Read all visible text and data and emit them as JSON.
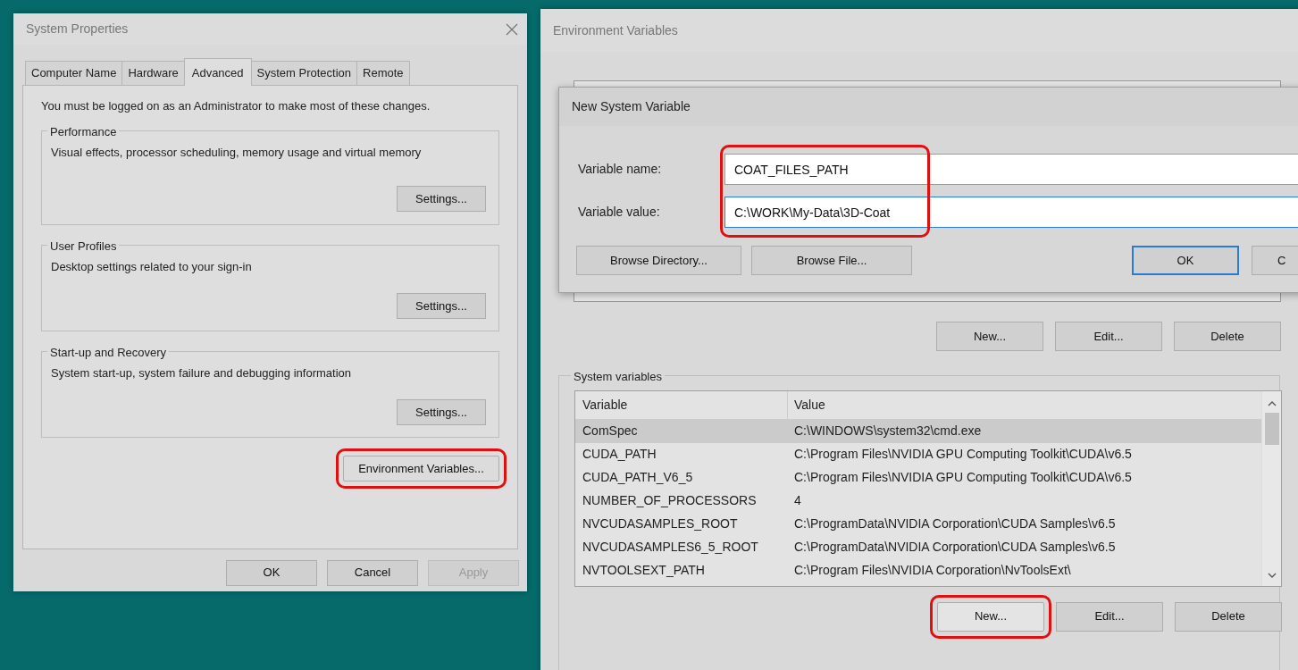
{
  "system_properties": {
    "title": "System Properties",
    "tabs": [
      {
        "label": "Computer Name",
        "selected": false
      },
      {
        "label": "Hardware",
        "selected": false
      },
      {
        "label": "Advanced",
        "selected": true
      },
      {
        "label": "System Protection",
        "selected": false
      },
      {
        "label": "Remote",
        "selected": false
      }
    ],
    "notice": "You must be logged on as an Administrator to make most of these changes.",
    "groups": [
      {
        "title": "Performance",
        "description": "Visual effects, processor scheduling, memory usage and virtual memory",
        "button": "Settings..."
      },
      {
        "title": "User Profiles",
        "description": "Desktop settings related to your sign-in",
        "button": "Settings..."
      },
      {
        "title": "Start-up and Recovery",
        "description": "System start-up, system failure and debugging information",
        "button": "Settings..."
      }
    ],
    "env_button": {
      "label": "Environment Variables...",
      "highlighted": true
    },
    "buttons": [
      {
        "label": "OK",
        "disabled": false
      },
      {
        "label": "Cancel",
        "disabled": false
      },
      {
        "label": "Apply",
        "disabled": true
      }
    ]
  },
  "environment_variables": {
    "title": "Environment Variables",
    "user_buttons": [
      {
        "label": "New...",
        "highlighted": false
      },
      {
        "label": "Edit...",
        "highlighted": false
      },
      {
        "label": "Delete",
        "highlighted": false
      }
    ],
    "system_group": "System variables",
    "columns": [
      "Variable",
      "Value"
    ],
    "rows": [
      {
        "variable": "ComSpec",
        "value": "C:\\WINDOWS\\system32\\cmd.exe",
        "selected": true
      },
      {
        "variable": "CUDA_PATH",
        "value": "C:\\Program Files\\NVIDIA GPU Computing Toolkit\\CUDA\\v6.5",
        "selected": false
      },
      {
        "variable": "CUDA_PATH_V6_5",
        "value": "C:\\Program Files\\NVIDIA GPU Computing Toolkit\\CUDA\\v6.5",
        "selected": false
      },
      {
        "variable": "NUMBER_OF_PROCESSORS",
        "value": "4",
        "selected": false
      },
      {
        "variable": "NVCUDASAMPLES_ROOT",
        "value": "C:\\ProgramData\\NVIDIA Corporation\\CUDA Samples\\v6.5",
        "selected": false
      },
      {
        "variable": "NVCUDASAMPLES6_5_ROOT",
        "value": "C:\\ProgramData\\NVIDIA Corporation\\CUDA Samples\\v6.5",
        "selected": false
      },
      {
        "variable": "NVTOOLSEXT_PATH",
        "value": "C:\\Program Files\\NVIDIA Corporation\\NvToolsExt\\",
        "selected": false
      }
    ],
    "system_buttons": [
      {
        "label": "New...",
        "highlighted": true
      },
      {
        "label": "Edit...",
        "highlighted": false
      },
      {
        "label": "Delete",
        "highlighted": false
      }
    ]
  },
  "new_system_variable": {
    "title": "New System Variable",
    "fields_highlighted": true,
    "fields": [
      {
        "label": "Variable name:",
        "value": "COAT_FILES_PATH",
        "focused": false
      },
      {
        "label": "Variable value:",
        "value": "C:\\WORK\\My-Data\\3D-Coat",
        "focused": true
      }
    ],
    "buttons": [
      {
        "label": "Browse Directory...",
        "default": false
      },
      {
        "label": "Browse File...",
        "default": false
      },
      {
        "label": "OK",
        "default": true
      },
      {
        "label": "C",
        "default": false
      }
    ]
  }
}
